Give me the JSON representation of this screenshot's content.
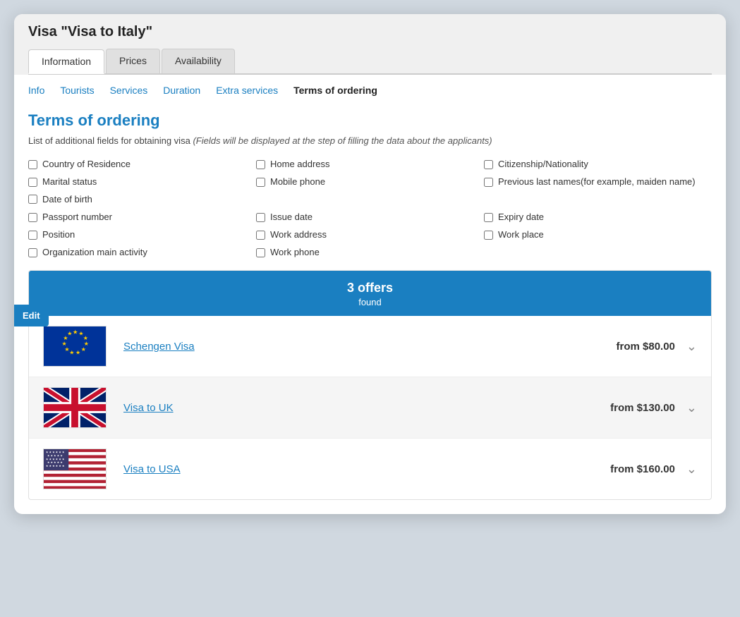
{
  "window": {
    "title": "Visa \"Visa to Italy\""
  },
  "topTabs": [
    {
      "label": "Information",
      "active": true
    },
    {
      "label": "Prices",
      "active": false
    },
    {
      "label": "Availability",
      "active": false
    }
  ],
  "subNav": [
    {
      "label": "Info",
      "active": false
    },
    {
      "label": "Tourists",
      "active": false
    },
    {
      "label": "Services",
      "active": false
    },
    {
      "label": "Duration",
      "active": false
    },
    {
      "label": "Extra services",
      "active": false
    },
    {
      "label": "Terms of ordering",
      "active": true
    }
  ],
  "section": {
    "heading": "Terms of ordering",
    "description": "List of additional fields for obtaining visa",
    "descriptionItalic": "(Fields will be displayed at the step of filling the data about the applicants)"
  },
  "fields": [
    {
      "label": "Country of Residence",
      "col": 1
    },
    {
      "label": "Home address",
      "col": 2
    },
    {
      "label": "Citizenship/Nationality",
      "col": 3
    },
    {
      "label": "Marital status",
      "col": 1
    },
    {
      "label": "Mobile phone",
      "col": 2
    },
    {
      "label": "Previous last names(for example, maiden name)",
      "col": 3
    },
    {
      "label": "Date of birth",
      "fullRow": true
    },
    {
      "label": "Passport number",
      "col": 1
    },
    {
      "label": "Issue date",
      "col": 2
    },
    {
      "label": "Expiry date",
      "col": 3
    },
    {
      "label": "Position",
      "col": 1
    },
    {
      "label": "Work address",
      "col": 2
    },
    {
      "label": "Work place",
      "col": 3
    },
    {
      "label": "Organization main activity",
      "col": 1
    },
    {
      "label": "Work phone",
      "col": 2
    }
  ],
  "editButton": {
    "label": "Edit"
  },
  "offers": {
    "header": "3 offers",
    "subheader": "found",
    "items": [
      {
        "name": "Schengen Visa",
        "price": "from $80.00",
        "flagType": "eu"
      },
      {
        "name": "Visa to UK",
        "price": "from $130.00",
        "flagType": "uk"
      },
      {
        "name": "Visa to USA",
        "price": "from $160.00",
        "flagType": "us"
      }
    ]
  }
}
